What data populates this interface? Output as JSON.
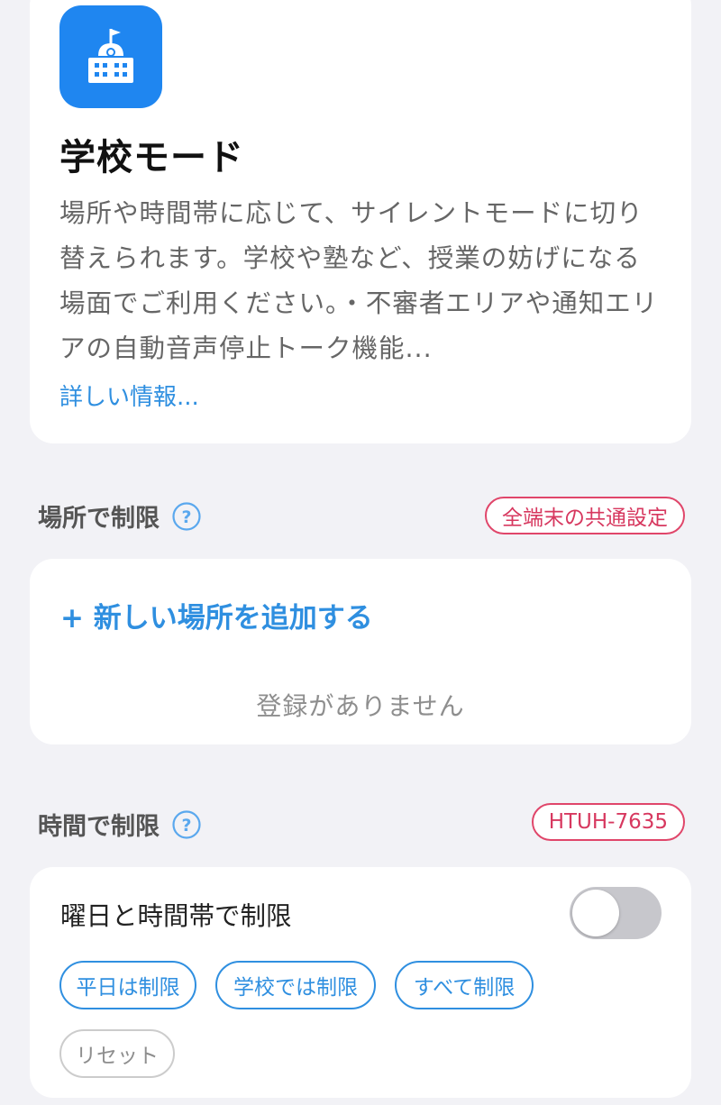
{
  "mode": {
    "icon": "school-building-icon",
    "title": "学校モード",
    "description": "場所や時間帯に応じて、サイレントモードに切り替えられます。学校や塾など、授業の妨げになる場面でご利用ください。・不審者エリアや通知エリアの自動音声停止トーク機能...",
    "more_link": "詳しい情報..."
  },
  "location_section": {
    "heading": "場所で制限",
    "tag": "全端末の共通設定",
    "add_label": "+ 新しい場所を追加する",
    "empty_message": "登録がありません"
  },
  "time_section": {
    "heading": "時間で制限",
    "tag": "HTUH-7635",
    "row_label": "曜日と時間帯で制限",
    "toggle_on": false,
    "presets": [
      "平日は制限",
      "学校では制限",
      "すべて制限"
    ],
    "reset_label": "リセット"
  },
  "colors": {
    "accent": "#2f8fe0",
    "tag_pink": "#e0466a",
    "background": "#f2f2f6",
    "icon_blue": "#1f86f0",
    "toggle_off": "#c7c7cc"
  }
}
